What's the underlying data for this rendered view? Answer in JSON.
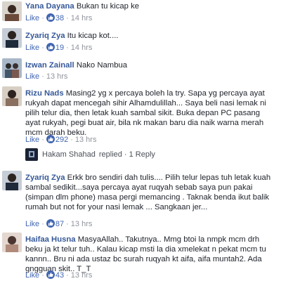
{
  "ui": {
    "like_label": "Like",
    "separator": "·"
  },
  "comments": [
    {
      "author": "Yana Dayana",
      "text": "Bukan tu kicap ke",
      "likes": "38",
      "time": "14 hrs"
    },
    {
      "author": "Zyariq Zya",
      "text": "Itu kicap kot....",
      "likes": "19",
      "time": "14 hrs"
    },
    {
      "author": "Izwan Zainall",
      "text": "Nako Nambua",
      "likes": "",
      "time": "13 hrs"
    },
    {
      "author": "Rizu Nads",
      "text": "Masing2 yg x percaya boleh la try. Sapa yg percaya ayat rukyah dapat mencegah sihir Alhamdulillah... Saya beli nasi lemak ni pilih telur dia, then letak kuah sambal sikit. Buka depan PC pasang ayat rukyah, pegi buat air, bila nk makan baru dia naik warna merah mcm darah beku.",
      "likes": "292",
      "time": "13 hrs",
      "reply": {
        "author": "Hakam Shahad",
        "action": "replied",
        "count": "1 Reply"
      }
    },
    {
      "author": "Zyariq Zya",
      "text": "Erkk bro sendiri dah tulis.... Pilih telur lepas tuh letak kuah sambal sedikit...saya percaya ayat ruqyah sebab saya pun pakai (simpan dlm phone) masa pergi memancing . Taknak benda ikut balik rumah but not for your nasi lemak ... Sangkaan jer...",
      "likes": "87",
      "time": "13 hrs"
    },
    {
      "author": "Haifaa Husna",
      "text": "MasyaAllah.. Takutnya.. Mmg btoi la nmpk mcm drh beku ja kt telur tuh.. Kalau kicap msti la dia xmelekat n pekat mcm tu kannn.. Bru ni ada ustaz bc surah ruqyah kt aifa, aifa muntah2. Ada gngguan skit.. T_T",
      "likes": "43",
      "time": "13 hrs"
    }
  ]
}
